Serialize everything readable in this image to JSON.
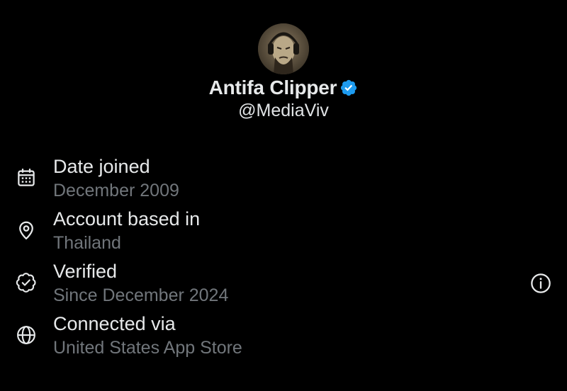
{
  "profile": {
    "display_name": "Antifa Clipper",
    "handle": "@MediaViv",
    "verified_badge_color": "#1d9bf0"
  },
  "about_items": [
    {
      "icon": "calendar-icon",
      "label": "Date joined",
      "value": "December 2009"
    },
    {
      "icon": "location-pin-icon",
      "label": "Account based in",
      "value": "Thailand"
    },
    {
      "icon": "verified-badge-outline-icon",
      "label": "Verified",
      "value": "Since December 2024"
    },
    {
      "icon": "globe-icon",
      "label": "Connected via",
      "value": "United States App Store"
    }
  ],
  "colors": {
    "background": "#000000",
    "primary_text": "#e7e9ea",
    "secondary_text": "#71767b",
    "icon": "#e7e9ea"
  }
}
